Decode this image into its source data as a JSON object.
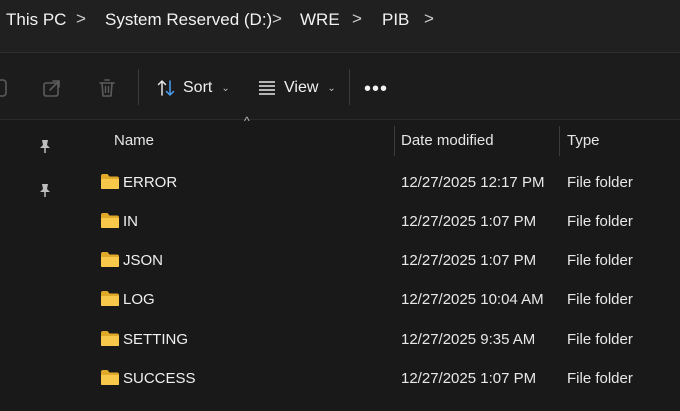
{
  "breadcrumb": {
    "items": [
      "This PC",
      "System Reserved (D:)",
      "WRE",
      "PIB"
    ],
    "separator": ">"
  },
  "toolbar": {
    "sort_label": "Sort",
    "view_label": "View",
    "more_label": "•••",
    "caret": "⌄"
  },
  "columns": {
    "name": "Name",
    "date": "Date modified",
    "type": "Type",
    "sort_indicator": "^"
  },
  "rows": [
    {
      "name": "ERROR",
      "date": "12/27/2025 12:17 PM",
      "type": "File folder"
    },
    {
      "name": "IN",
      "date": "12/27/2025 1:07 PM",
      "type": "File folder"
    },
    {
      "name": "JSON",
      "date": "12/27/2025 1:07 PM",
      "type": "File folder"
    },
    {
      "name": "LOG",
      "date": "12/27/2025 10:04 AM",
      "type": "File folder"
    },
    {
      "name": "SETTING",
      "date": "12/27/2025 9:35 AM",
      "type": "File folder"
    },
    {
      "name": "SUCCESS",
      "date": "12/27/2025 1:07 PM",
      "type": "File folder"
    }
  ],
  "colors": {
    "background": "#191919",
    "folder": "#f8c84a",
    "folder_dark": "#e0a92a"
  }
}
